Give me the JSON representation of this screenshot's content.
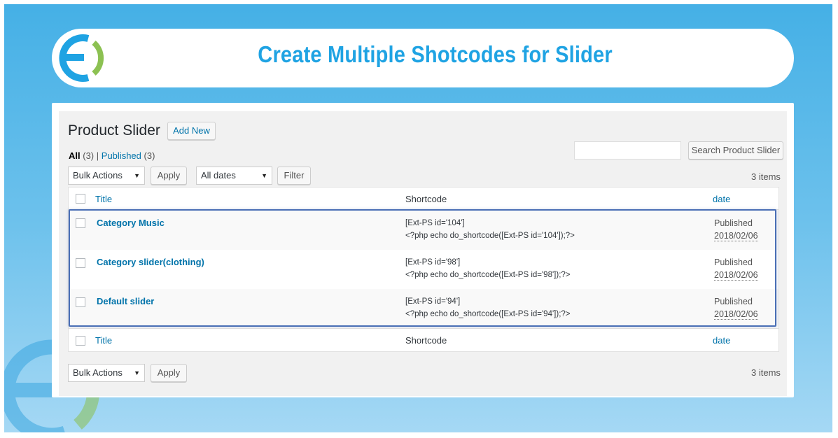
{
  "banner": {
    "title": "Create Multiple Shotcodes for Slider",
    "logo_icon": "ring-logo-icon"
  },
  "colors": {
    "background_top": "#45b0e6",
    "background_bottom": "#a5d8f4",
    "title": "#1fa3e3",
    "link": "#0073aa",
    "highlight_border": "#4a6fb5",
    "logo_blue": "#1fa3e3",
    "logo_green": "#8cc152"
  },
  "page": {
    "title": "Product Slider",
    "add_new": "Add New"
  },
  "views": {
    "all_label": "All",
    "all_count": "(3)",
    "separator": "|",
    "published_label": "Published",
    "published_count": "(3)"
  },
  "search": {
    "value": "",
    "button": "Search Product Slider"
  },
  "top_nav": {
    "bulk_actions": "Bulk Actions",
    "apply": "Apply",
    "dates": "All dates",
    "filter": "Filter",
    "items": "3 items"
  },
  "table": {
    "columns": {
      "title": "Title",
      "shortcode": "Shortcode",
      "date": "date"
    },
    "rows": [
      {
        "title": "Category Music",
        "shortcode": "[Ext-PS id='104']",
        "php": "<?php echo do_shortcode([Ext-PS id='104']);?>",
        "status": "Published",
        "date": "2018/02/06"
      },
      {
        "title": "Category slider(clothing)",
        "shortcode": "[Ext-PS id='98']",
        "php": "<?php echo do_shortcode([Ext-PS id='98']);?>",
        "status": "Published",
        "date": "2018/02/06"
      },
      {
        "title": "Default slider",
        "shortcode": "[Ext-PS id='94']",
        "php": "<?php echo do_shortcode([Ext-PS id='94']);?>",
        "status": "Published",
        "date": "2018/02/06"
      }
    ]
  },
  "bottom_nav": {
    "bulk_actions": "Bulk Actions",
    "apply": "Apply",
    "items": "3 items"
  }
}
